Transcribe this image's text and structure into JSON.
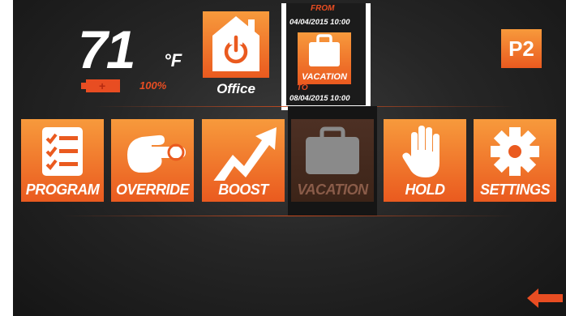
{
  "status": {
    "temperature": "71",
    "unit": "°F",
    "battery_percent": "100%",
    "battery_icon": "battery-charging-icon"
  },
  "location": {
    "label": "Office",
    "icon": "house-power-icon"
  },
  "vacation_schedule": {
    "from_label": "FROM",
    "from_date": "04/04/2015 10:00",
    "mode_label": "VACATION",
    "to_label": "TO",
    "to_date": "08/04/2015 10:00",
    "icon": "suitcase-icon"
  },
  "profile": {
    "label": "P2"
  },
  "menu": {
    "items": [
      {
        "label": "PROGRAM",
        "icon": "checklist-icon",
        "enabled": true
      },
      {
        "label": "OVERRIDE",
        "icon": "pointing-hand-icon",
        "enabled": true
      },
      {
        "label": "BOOST",
        "icon": "trend-up-arrow-icon",
        "enabled": true
      },
      {
        "label": "VACATION",
        "icon": "suitcase-icon",
        "enabled": false
      },
      {
        "label": "HOLD",
        "icon": "raised-hand-icon",
        "enabled": true
      },
      {
        "label": "SETTINGS",
        "icon": "gear-icon",
        "enabled": true
      }
    ]
  },
  "navigation": {
    "back_icon": "back-arrow-icon"
  },
  "colors": {
    "accent": "#e84d22",
    "tile_top": "#f79a3c",
    "tile_bottom": "#ea5a1f",
    "background": "#262626"
  }
}
